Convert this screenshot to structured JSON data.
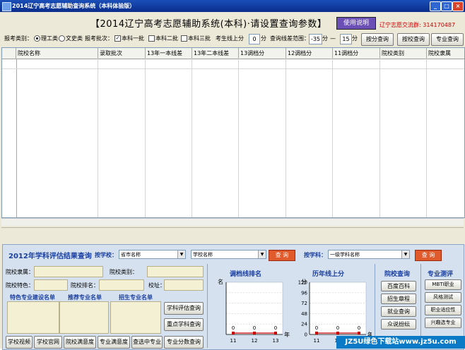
{
  "window": {
    "title": "2014辽宁高考志愿辅助查询系统（本科体验版）",
    "minimize": "_",
    "restore": "□",
    "close": "×"
  },
  "header": {
    "headline": "【2014辽宁高考志愿辅助系统(本科)·请设置查询参数】",
    "use_button": "使用说明",
    "qq_label": "辽宁志愿交流群:",
    "qq_number": "314170487"
  },
  "controls": {
    "category_label": "报考类别：",
    "science": "理工类",
    "arts": "文史类",
    "batch_label": "报考批次：",
    "batch1": "本科一批",
    "batch2": "本科二批",
    "batch3": "本科三批",
    "student_line_label": "考生线上分",
    "student_line_value": "0",
    "fen": "分",
    "range_label": "查询线差范围：",
    "range_from": "-35",
    "fen2": "分",
    "dash": "—",
    "range_to": "15",
    "fen3": "分",
    "query_score": "按分查询",
    "query_school": "按校查询",
    "query_major": "专业查询"
  },
  "grid": {
    "columns": [
      "院校名称",
      "录取批次",
      "13年一本线差",
      "13年二本线差",
      "13调档分",
      "12调档分",
      "11调档分",
      "院校类别",
      "院校隶属"
    ]
  },
  "evaluation": {
    "title": "2012年学科评估结果查询",
    "by_school_label": "按学校：",
    "province_select": "省市名称",
    "school_select": "学校名称",
    "query1": "查 询",
    "by_subject_label": "按学科：",
    "subject_select": "一级学科名称",
    "query2": "查 询"
  },
  "school_info": {
    "affiliation": "院校隶属：",
    "category": "院校类别：",
    "features": "院校特色：",
    "rank": "院校排名：",
    "campus": "校址：",
    "special_majors": "特色专业建设名单",
    "recommended_majors": "推荐专业名单",
    "enrolled_majors": "招生专业名单",
    "eval_query": "学科评估查询",
    "key_query": "重点学科查询",
    "major_score_query": "专业分数查询"
  },
  "bottom_buttons": [
    "学校视频",
    "学校官网",
    "院校满意度",
    "专业满意度",
    "查选中专业"
  ],
  "charts": {
    "chart1_title": "调档线排名",
    "chart2_title": "历年线上分"
  },
  "chart_data": [
    {
      "type": "line",
      "title": "调档线排名",
      "ylabel": "名",
      "xlabel": "年",
      "x": [
        "11",
        "12",
        "13"
      ],
      "series": [
        {
          "values": [
            0,
            0,
            0
          ]
        }
      ],
      "data_labels": [
        "0",
        "0",
        "0"
      ],
      "grid": true
    },
    {
      "type": "line",
      "title": "历年线上分",
      "ylabel": "分",
      "xlabel": "年",
      "x": [
        "11",
        "12",
        "13"
      ],
      "yticks": [
        "120",
        "96",
        "72",
        "48",
        "24",
        "0"
      ],
      "ylim": [
        0,
        120
      ],
      "series": [
        {
          "values": [
            0,
            0,
            0
          ]
        }
      ],
      "data_labels": [
        "0",
        "0",
        "0"
      ],
      "grid": true
    }
  ],
  "sidebar1": {
    "title": "院校查询",
    "items": [
      "百度百科",
      "招生章程",
      "就业查询",
      "众说纷纭"
    ]
  },
  "sidebar2": {
    "title": "专业测评",
    "items": [
      "MBTI职业",
      "风格测试",
      "职业适应性",
      "兴趣选专业"
    ]
  },
  "watermark": "JZ5U绿色下载站www.jz5u.com"
}
